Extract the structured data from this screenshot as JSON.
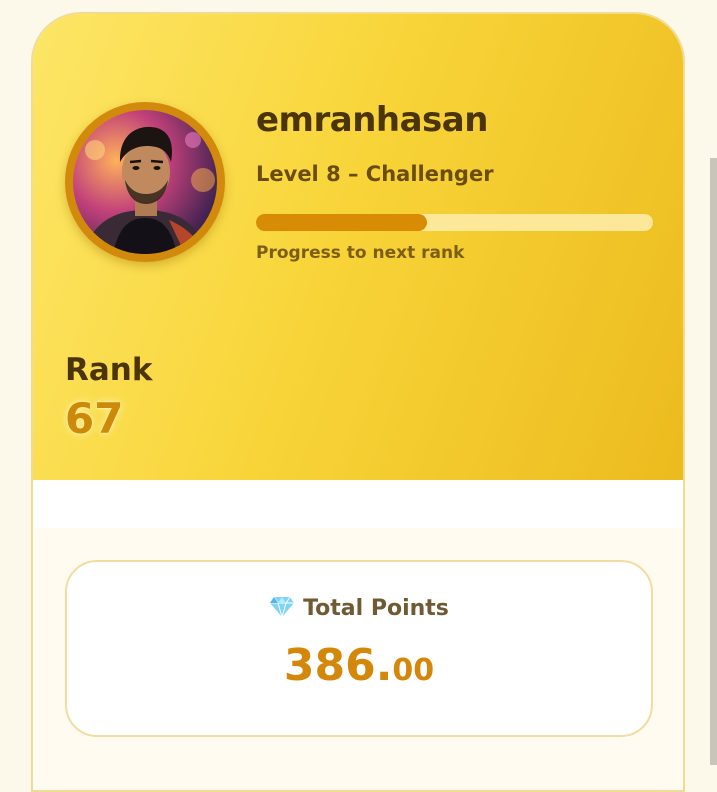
{
  "profile": {
    "username": "emranhasan",
    "level_text": "Level 8 – Challenger",
    "progress_fraction": 0.43,
    "progress_caption": "Progress to next rank"
  },
  "rank": {
    "label": "Rank",
    "value": "67"
  },
  "points": {
    "label": "Total Points",
    "icon": "gem-icon",
    "integer_part": "386.",
    "decimal_part": "00"
  },
  "colors": {
    "accent": "#d88b04",
    "hero_gradient_start": "#fde667",
    "hero_gradient_end": "#ecbb1e",
    "dark_text": "#4a3408"
  }
}
